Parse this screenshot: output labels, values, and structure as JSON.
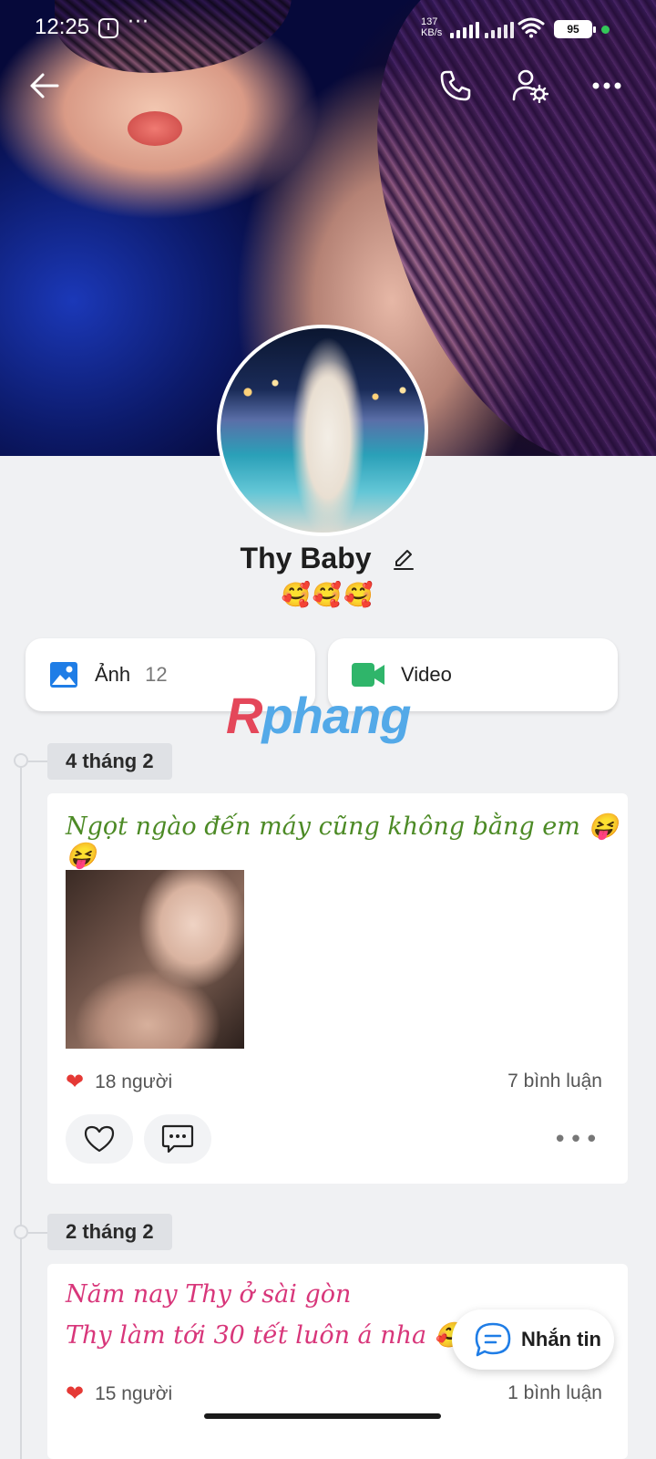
{
  "status_bar": {
    "time": "12:25",
    "more_dots": "···",
    "net_speed_value": "137",
    "net_speed_unit": "KB/s",
    "battery": "95"
  },
  "header": {
    "back_icon": "arrow-left-icon",
    "call_icon": "phone-icon",
    "settings_icon": "user-settings-icon",
    "more_icon": "more-horizontal-icon"
  },
  "profile": {
    "name": "Thy Baby",
    "status_emojis": "🥰🥰🥰"
  },
  "media": {
    "photos_label": "Ảnh",
    "photos_count": "12",
    "video_label": "Video",
    "photos_color": "#1f7de6",
    "video_color": "#2fb56a"
  },
  "watermark": {
    "first": "R",
    "rest": "phang"
  },
  "posts": [
    {
      "date": "4 tháng 2",
      "text": "Ngọt ngào đến máy cũng không bằng em 😝😝",
      "text_color": "#4c8a25",
      "likes": "18 người",
      "comments": "7 bình luận"
    },
    {
      "date": "2 tháng 2",
      "text_line1": "Năm nay Thy ở sài gòn",
      "text_line2": "Thy làm tới 30 tết luôn á nha 🥰",
      "text_color": "#d8367a",
      "likes": "15 người",
      "comments": "1 bình luận"
    }
  ],
  "message_button": {
    "label": "Nhắn tin"
  }
}
